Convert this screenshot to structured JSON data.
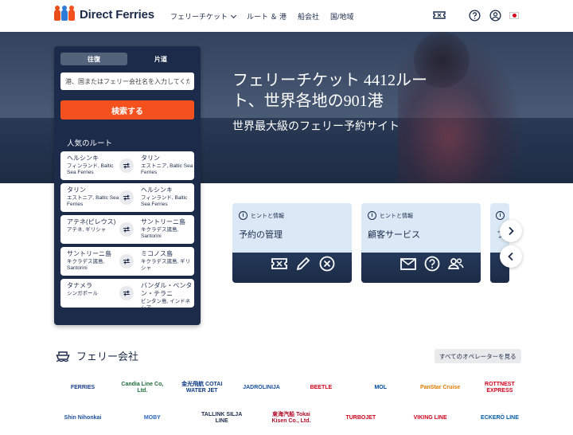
{
  "header": {
    "brand": "Direct Ferries",
    "brand_colors": [
      "#e94e1b",
      "#2f7bd8",
      "#f4511e"
    ],
    "nav": [
      {
        "label": "フェリーチケット",
        "has_dropdown": true
      },
      {
        "label": "ルート ＆ 港"
      },
      {
        "label": "船会社"
      },
      {
        "label": "国/地域"
      }
    ],
    "icons": [
      "ticket-icon",
      "help-icon",
      "account-icon",
      "japan-flag-icon"
    ]
  },
  "hero": {
    "title": "フェリーチケット 4412ルート、世界各地の901港",
    "subtitle": "世界最大級のフェリー予約サイト"
  },
  "search": {
    "tabs": [
      {
        "label": "往復",
        "active": true
      },
      {
        "label": "片道",
        "active": false
      }
    ],
    "placeholder": "港、国またはフェリー会社名を入力してください",
    "value": "",
    "button": "検索する",
    "button_color": "#f4511e",
    "popular_title": "人気のルート",
    "routes": [
      {
        "from_city": "ヘルシンキ",
        "from_country": "フィンランド, Baltic Sea Ferries",
        "to_city": "タリン",
        "to_country": "エストニア, Baltic Sea Ferries"
      },
      {
        "from_city": "タリン",
        "from_country": "エストニア, Baltic Sea Ferries",
        "to_city": "ヘルシンキ",
        "to_country": "フィンランド, Baltic Sea Ferries"
      },
      {
        "from_city": "アテネ(ピレウス)",
        "from_country": "アテネ, ギリシャ",
        "to_city": "サントリーニ島",
        "to_country": "キクラデス諸島, Santorini"
      },
      {
        "from_city": "サントリーニ島",
        "from_country": "キクラデス諸島, Santorini",
        "to_city": "ミコノス島",
        "to_country": "キクラデス諸島, ギリシャ"
      },
      {
        "from_city": "タナメラ",
        "from_country": "シンガポール",
        "to_city": "バンダル・ベンタン・テラニ",
        "to_country": "ビンタン島, インドネシア"
      }
    ]
  },
  "cards": [
    {
      "tag": "ヒントと情報",
      "title": "予約の管理",
      "icons": [
        "ticket-icon",
        "pencil-icon",
        "cancel-icon"
      ]
    },
    {
      "tag": "ヒントと情報",
      "title": "顧客サービス",
      "icons": [
        "mail-icon",
        "question-icon",
        "people-icon"
      ]
    },
    {
      "tag": "ヒ",
      "title": "フ",
      "icons": []
    }
  ],
  "operators": {
    "title": "フェリー会社",
    "see_all": "すべてのオペレーターを見る",
    "logos_row1": [
      {
        "name": "FERRIES",
        "color": "#1c3f8c"
      },
      {
        "name": "Candia Line Co, Ltd.",
        "color": "#1f6b3a"
      },
      {
        "name": "金光飛航 COTAI WATER JET",
        "color": "#0e3b84"
      },
      {
        "name": "JADROLINIJA",
        "color": "#1a4f9c"
      },
      {
        "name": "BEETLE",
        "color": "#d0021b"
      },
      {
        "name": "MOL",
        "color": "#004a9b"
      },
      {
        "name": "PanStar Cruise",
        "color": "#e07b00"
      },
      {
        "name": "ROTTNEST EXPRESS",
        "color": "#d0021b"
      }
    ],
    "logos_row2": [
      {
        "name": "Shin Nihonkai",
        "color": "#1c4f9c"
      },
      {
        "name": "MOBY",
        "color": "#2b65c6"
      },
      {
        "name": "TALLINK SILJA LINE",
        "color": "#1c2b4a"
      },
      {
        "name": "東海汽船 Tokai Kisen Co., Ltd.",
        "color": "#b0102a"
      },
      {
        "name": "TURBOJET",
        "color": "#d0021b"
      },
      {
        "name": "VIKING LINE",
        "color": "#d0021b"
      },
      {
        "name": "ECKERÖ LINE",
        "color": "#005aa9"
      }
    ]
  }
}
